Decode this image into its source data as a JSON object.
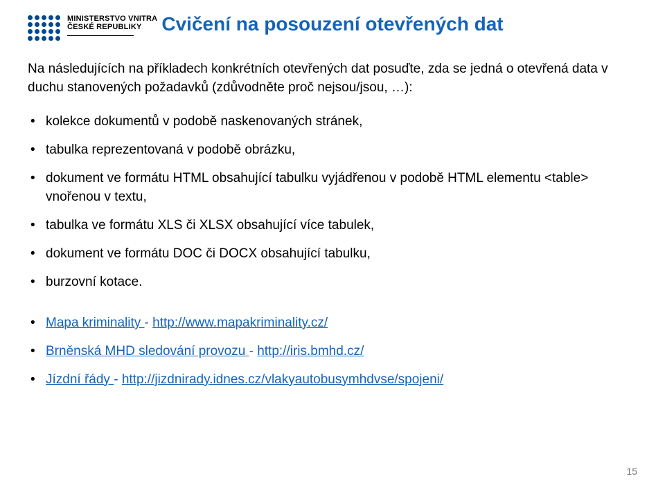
{
  "logo": {
    "line1": "MINISTERSTVO VNITRA",
    "line2": "ČESKÉ REPUBLIKY",
    "dot_color": "#004a8f"
  },
  "title": "Cvičení na posouzení otevřených dat",
  "intro": "Na následujících na příkladech konkrétních otevřených dat posuďte, zda se jedná o otevřená data v duchu stanovených požadavků (zdůvodněte proč nejsou/jsou, …):",
  "items": [
    "kolekce dokumentů v podobě naskenovaných stránek,",
    "tabulka reprezentovaná v podobě obrázku,",
    "dokument ve formátu HTML obsahující tabulku vyjádřenou v podobě HTML elementu <table> vnořenou v textu,",
    "tabulka ve formátu XLS či XLSX obsahující více tabulek,",
    "dokument ve formátu DOC či DOCX obsahující tabulku,",
    "burzovní kotace."
  ],
  "links": [
    {
      "label": "Mapa kriminality ",
      "sep": "- ",
      "url": "http://www.mapakriminality.cz/"
    },
    {
      "label": "Brněnská MHD sledování provozu ",
      "sep": "- ",
      "url": "http://iris.bmhd.cz/"
    },
    {
      "label": "Jízdní řády ",
      "sep": "- ",
      "url": "http://jizdnirady.idnes.cz/vlakyautobusymhdvse/spojeni/"
    }
  ],
  "page_number": "15"
}
